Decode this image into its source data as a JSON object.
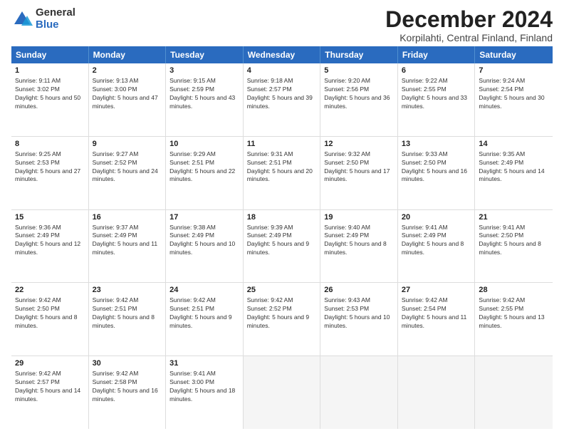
{
  "logo": {
    "general": "General",
    "blue": "Blue"
  },
  "title": "December 2024",
  "subtitle": "Korpilahti, Central Finland, Finland",
  "weekdays": [
    "Sunday",
    "Monday",
    "Tuesday",
    "Wednesday",
    "Thursday",
    "Friday",
    "Saturday"
  ],
  "weeks": [
    [
      {
        "day": "1",
        "rise": "Sunrise: 9:11 AM",
        "set": "Sunset: 3:02 PM",
        "light": "Daylight: 5 hours and 50 minutes."
      },
      {
        "day": "2",
        "rise": "Sunrise: 9:13 AM",
        "set": "Sunset: 3:00 PM",
        "light": "Daylight: 5 hours and 47 minutes."
      },
      {
        "day": "3",
        "rise": "Sunrise: 9:15 AM",
        "set": "Sunset: 2:59 PM",
        "light": "Daylight: 5 hours and 43 minutes."
      },
      {
        "day": "4",
        "rise": "Sunrise: 9:18 AM",
        "set": "Sunset: 2:57 PM",
        "light": "Daylight: 5 hours and 39 minutes."
      },
      {
        "day": "5",
        "rise": "Sunrise: 9:20 AM",
        "set": "Sunset: 2:56 PM",
        "light": "Daylight: 5 hours and 36 minutes."
      },
      {
        "day": "6",
        "rise": "Sunrise: 9:22 AM",
        "set": "Sunset: 2:55 PM",
        "light": "Daylight: 5 hours and 33 minutes."
      },
      {
        "day": "7",
        "rise": "Sunrise: 9:24 AM",
        "set": "Sunset: 2:54 PM",
        "light": "Daylight: 5 hours and 30 minutes."
      }
    ],
    [
      {
        "day": "8",
        "rise": "Sunrise: 9:25 AM",
        "set": "Sunset: 2:53 PM",
        "light": "Daylight: 5 hours and 27 minutes."
      },
      {
        "day": "9",
        "rise": "Sunrise: 9:27 AM",
        "set": "Sunset: 2:52 PM",
        "light": "Daylight: 5 hours and 24 minutes."
      },
      {
        "day": "10",
        "rise": "Sunrise: 9:29 AM",
        "set": "Sunset: 2:51 PM",
        "light": "Daylight: 5 hours and 22 minutes."
      },
      {
        "day": "11",
        "rise": "Sunrise: 9:31 AM",
        "set": "Sunset: 2:51 PM",
        "light": "Daylight: 5 hours and 20 minutes."
      },
      {
        "day": "12",
        "rise": "Sunrise: 9:32 AM",
        "set": "Sunset: 2:50 PM",
        "light": "Daylight: 5 hours and 17 minutes."
      },
      {
        "day": "13",
        "rise": "Sunrise: 9:33 AM",
        "set": "Sunset: 2:50 PM",
        "light": "Daylight: 5 hours and 16 minutes."
      },
      {
        "day": "14",
        "rise": "Sunrise: 9:35 AM",
        "set": "Sunset: 2:49 PM",
        "light": "Daylight: 5 hours and 14 minutes."
      }
    ],
    [
      {
        "day": "15",
        "rise": "Sunrise: 9:36 AM",
        "set": "Sunset: 2:49 PM",
        "light": "Daylight: 5 hours and 12 minutes."
      },
      {
        "day": "16",
        "rise": "Sunrise: 9:37 AM",
        "set": "Sunset: 2:49 PM",
        "light": "Daylight: 5 hours and 11 minutes."
      },
      {
        "day": "17",
        "rise": "Sunrise: 9:38 AM",
        "set": "Sunset: 2:49 PM",
        "light": "Daylight: 5 hours and 10 minutes."
      },
      {
        "day": "18",
        "rise": "Sunrise: 9:39 AM",
        "set": "Sunset: 2:49 PM",
        "light": "Daylight: 5 hours and 9 minutes."
      },
      {
        "day": "19",
        "rise": "Sunrise: 9:40 AM",
        "set": "Sunset: 2:49 PM",
        "light": "Daylight: 5 hours and 8 minutes."
      },
      {
        "day": "20",
        "rise": "Sunrise: 9:41 AM",
        "set": "Sunset: 2:49 PM",
        "light": "Daylight: 5 hours and 8 minutes."
      },
      {
        "day": "21",
        "rise": "Sunrise: 9:41 AM",
        "set": "Sunset: 2:50 PM",
        "light": "Daylight: 5 hours and 8 minutes."
      }
    ],
    [
      {
        "day": "22",
        "rise": "Sunrise: 9:42 AM",
        "set": "Sunset: 2:50 PM",
        "light": "Daylight: 5 hours and 8 minutes."
      },
      {
        "day": "23",
        "rise": "Sunrise: 9:42 AM",
        "set": "Sunset: 2:51 PM",
        "light": "Daylight: 5 hours and 8 minutes."
      },
      {
        "day": "24",
        "rise": "Sunrise: 9:42 AM",
        "set": "Sunset: 2:51 PM",
        "light": "Daylight: 5 hours and 9 minutes."
      },
      {
        "day": "25",
        "rise": "Sunrise: 9:42 AM",
        "set": "Sunset: 2:52 PM",
        "light": "Daylight: 5 hours and 9 minutes."
      },
      {
        "day": "26",
        "rise": "Sunrise: 9:43 AM",
        "set": "Sunset: 2:53 PM",
        "light": "Daylight: 5 hours and 10 minutes."
      },
      {
        "day": "27",
        "rise": "Sunrise: 9:42 AM",
        "set": "Sunset: 2:54 PM",
        "light": "Daylight: 5 hours and 11 minutes."
      },
      {
        "day": "28",
        "rise": "Sunrise: 9:42 AM",
        "set": "Sunset: 2:55 PM",
        "light": "Daylight: 5 hours and 13 minutes."
      }
    ],
    [
      {
        "day": "29",
        "rise": "Sunrise: 9:42 AM",
        "set": "Sunset: 2:57 PM",
        "light": "Daylight: 5 hours and 14 minutes."
      },
      {
        "day": "30",
        "rise": "Sunrise: 9:42 AM",
        "set": "Sunset: 2:58 PM",
        "light": "Daylight: 5 hours and 16 minutes."
      },
      {
        "day": "31",
        "rise": "Sunrise: 9:41 AM",
        "set": "Sunset: 3:00 PM",
        "light": "Daylight: 5 hours and 18 minutes."
      },
      {
        "day": "",
        "rise": "",
        "set": "",
        "light": ""
      },
      {
        "day": "",
        "rise": "",
        "set": "",
        "light": ""
      },
      {
        "day": "",
        "rise": "",
        "set": "",
        "light": ""
      },
      {
        "day": "",
        "rise": "",
        "set": "",
        "light": ""
      }
    ]
  ]
}
